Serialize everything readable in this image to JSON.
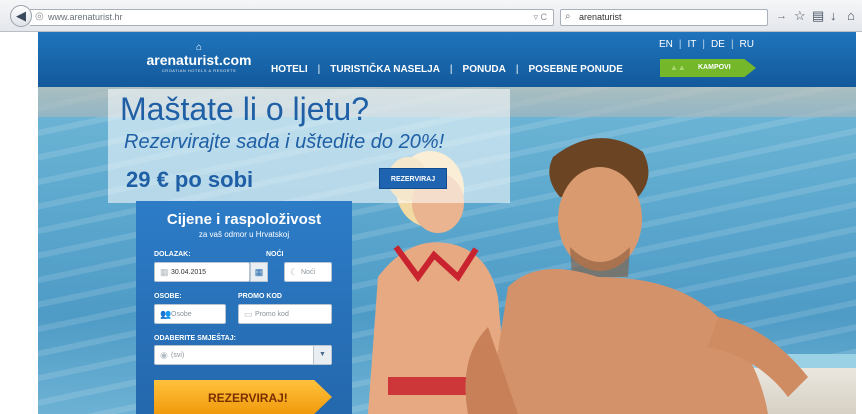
{
  "browser": {
    "url": "www.arenaturist.hr",
    "search_query": "arenaturist",
    "icons": [
      "back-icon",
      "globe-icon",
      "reload-icon",
      "search-icon",
      "go-icon",
      "star-icon",
      "bookmarks-icon",
      "download-icon",
      "home-icon"
    ]
  },
  "header": {
    "languages": [
      "EN",
      "IT",
      "DE",
      "RU"
    ],
    "logo_name": "arenaturist.com",
    "logo_tagline": "CROATIAN HOTELS & RESORTS",
    "nav": [
      "HOTELI",
      "TURISTIČKA NASELJA",
      "PONUDA",
      "POSEBNE PONUDE"
    ],
    "kampovi_label": "KAMPOVI",
    "colors": {
      "header_blue": "#1a66ad",
      "kampovi_green": "#74b72b"
    }
  },
  "promo": {
    "title": "Maštate li o ljetu?",
    "subtitle": "Rezervirajte sada i uštedite do 20%!",
    "price": "29 €   po sobi",
    "button": "REZERVIRAJ"
  },
  "booking": {
    "title": "Cijene i raspoloživost",
    "subtitle": "za vaš odmor u Hrvatskoj",
    "arrival_label": "DOLAZAK:",
    "arrival_value": "30.04.2015",
    "nights_label": "NOĆI",
    "nights_placeholder": "Noći",
    "persons_label": "OSOBE:",
    "persons_placeholder": "Osobe",
    "promo_label": "PROMO KOD",
    "promo_placeholder": "Promo kod",
    "accommodation_label": "ODABERITE SMJEŠTAJ:",
    "accommodation_value": "(svi)",
    "submit": "REZERVIRAJ!",
    "colors": {
      "panel_blue": "#2870b8",
      "submit_orange": "#f5a51c"
    }
  }
}
